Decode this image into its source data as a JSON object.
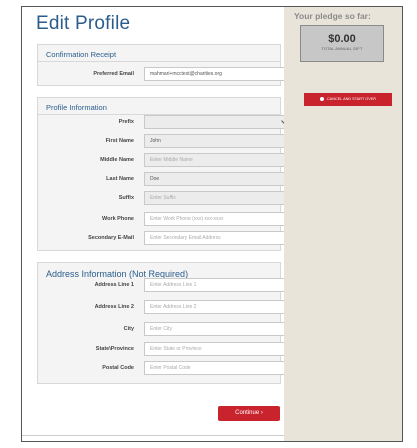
{
  "page": {
    "title": "Edit Profile"
  },
  "confirmation": {
    "title": "Confirmation Receipt",
    "email_label": "Preferred Email",
    "email_value": "mahmari+mcctest@charities.org"
  },
  "profile": {
    "title": "Profile Information",
    "fields": [
      {
        "label": "Prefix",
        "value": "",
        "placeholder": ""
      },
      {
        "label": "First Name",
        "value": "John",
        "placeholder": ""
      },
      {
        "label": "Middle Name",
        "value": "",
        "placeholder": "Enter Middle Name"
      },
      {
        "label": "Last Name",
        "value": "Doe",
        "placeholder": ""
      },
      {
        "label": "Suffix",
        "value": "",
        "placeholder": "Enter Suffix"
      },
      {
        "label": "Work Phone",
        "value": "",
        "placeholder": "Enter Work Phone (xxx) xxx-xxxx"
      },
      {
        "label": "Secondary E-Mail",
        "value": "",
        "placeholder": "Enter Secondary Email Address"
      }
    ]
  },
  "address": {
    "title": "Address Information (Not Required)",
    "fields": [
      {
        "label": "Address Line 1",
        "placeholder": "Enter Address Line 1"
      },
      {
        "label": "Address Line 2",
        "placeholder": "Enter Address Line 2"
      },
      {
        "label": "City",
        "placeholder": "Enter City"
      },
      {
        "label": "State\\Province",
        "placeholder": "Enter State or Province"
      },
      {
        "label": "Postal Code",
        "placeholder": "Enter Postal Code"
      }
    ]
  },
  "actions": {
    "continue_label": "Continue ›"
  },
  "sidebar": {
    "pledge_title": "Your pledge so far:",
    "pledge_amount": "$0.00",
    "pledge_caption": "TOTAL ANNUAL GIFT",
    "cancel_label": "CANCEL AND START OVER"
  },
  "colors": {
    "heading_blue": "#2a5d8c",
    "accent_red": "#c9232e",
    "sidebar_beige": "#e9e4da"
  }
}
